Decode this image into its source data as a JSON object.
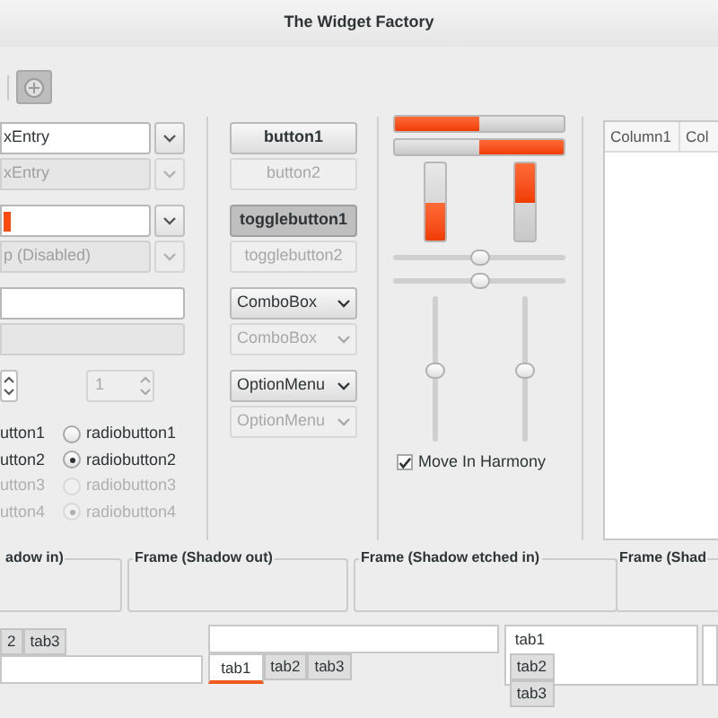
{
  "window": {
    "title": "The Widget Factory"
  },
  "entries": [
    {
      "kind": "combo-entry",
      "value": "xEntry",
      "disabled": false
    },
    {
      "kind": "combo-entry",
      "value": "xEntry",
      "disabled": true
    },
    {
      "kind": "selected-combo-entry",
      "disabled": false
    },
    {
      "kind": "combo-entry",
      "value": "p (Disabled)",
      "disabled": true
    },
    {
      "kind": "entry",
      "disabled": false
    },
    {
      "kind": "entry",
      "disabled": true
    }
  ],
  "spin_buttons": [
    {
      "disabled": false
    },
    {
      "value": "1",
      "disabled": true
    }
  ],
  "check_buttons": [
    {
      "label": "utton1",
      "disabled": false
    },
    {
      "label": "utton2",
      "disabled": false
    },
    {
      "label": "utton3",
      "disabled": true
    },
    {
      "label": "utton4",
      "disabled": true
    }
  ],
  "radio_buttons": [
    {
      "label": "radiobutton1",
      "selected": false,
      "disabled": false
    },
    {
      "label": "radiobutton2",
      "selected": true,
      "disabled": false
    },
    {
      "label": "radiobutton3",
      "selected": false,
      "disabled": true
    },
    {
      "label": "radiobutton4",
      "selected": true,
      "disabled": true
    }
  ],
  "buttons": [
    {
      "kind": "button",
      "label": "button1",
      "disabled": false,
      "pressed": false
    },
    {
      "kind": "button",
      "label": "button2",
      "disabled": true,
      "pressed": false
    },
    {
      "kind": "button",
      "label": "togglebutton1",
      "disabled": false,
      "pressed": true
    },
    {
      "kind": "button",
      "label": "togglebutton2",
      "disabled": true,
      "pressed": false
    },
    {
      "kind": "combo",
      "label": "ComboBox",
      "disabled": false,
      "pressed": false
    },
    {
      "kind": "combo",
      "label": "ComboBox",
      "disabled": true,
      "pressed": false
    },
    {
      "kind": "combo",
      "label": "OptionMenu",
      "disabled": false,
      "pressed": false
    },
    {
      "kind": "combo",
      "label": "OptionMenu",
      "disabled": true,
      "pressed": false
    }
  ],
  "progress_bars": [
    {
      "kind": "horizontal",
      "inverted": false,
      "level": 0.5
    },
    {
      "kind": "horizontal",
      "inverted": true,
      "level": 0.5
    },
    {
      "kind": "vertical",
      "inverted": true,
      "level": 0.5
    },
    {
      "kind": "vertical",
      "inverted": false,
      "level": 0.5
    }
  ],
  "scales": [
    {
      "kind": "horizontal",
      "level": 0.5
    },
    {
      "kind": "horizontal",
      "level": 0.5
    },
    {
      "kind": "vertical",
      "level": 0.5
    },
    {
      "kind": "vertical",
      "level": 0.5
    }
  ],
  "harmony_check": {
    "label": "Move In Harmony",
    "checked": true
  },
  "tree_view": {
    "columns": [
      "Column1",
      "Col"
    ]
  },
  "frames": [
    {
      "label": "adow in)"
    },
    {
      "label": "Frame (Shadow out)"
    },
    {
      "label": "Frame (Shadow etched in)"
    },
    {
      "label": "Frame (Shad"
    }
  ],
  "notebooks": [
    {
      "kind": "top",
      "tabs": [
        {
          "label": "2",
          "selected": false
        },
        {
          "label": "tab3",
          "selected": false
        }
      ]
    },
    {
      "kind": "bottom",
      "tabs": [
        {
          "label": "tab1",
          "selected": true
        },
        {
          "label": "tab2",
          "selected": false
        },
        {
          "label": "tab3",
          "selected": false
        }
      ]
    },
    {
      "kind": "left",
      "tabs": [
        {
          "label": "tab1",
          "selected": true
        },
        {
          "label": "tab2",
          "selected": false
        },
        {
          "label": "tab3",
          "selected": false
        }
      ]
    }
  ]
}
